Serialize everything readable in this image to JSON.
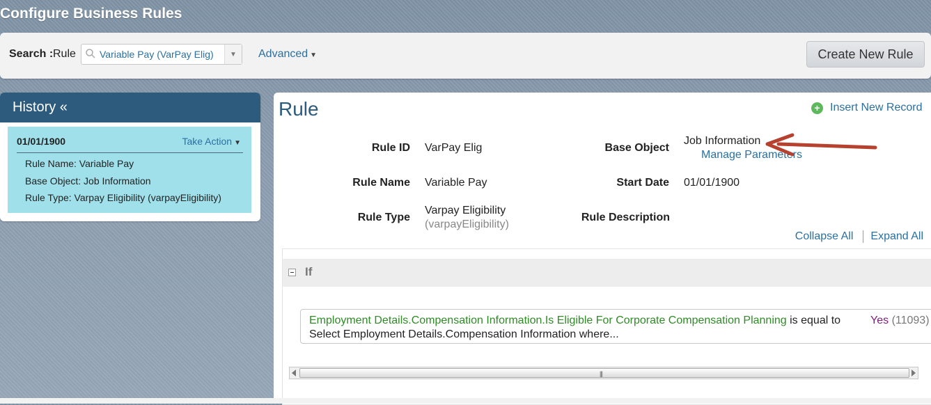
{
  "page": {
    "title": "Configure Business Rules"
  },
  "search": {
    "label": "Search :",
    "sublabel": "Rule",
    "value": "Variable Pay (VarPay Elig)",
    "advanced_label": "Advanced",
    "create_button": "Create New Rule"
  },
  "history": {
    "header": "History «",
    "card": {
      "date": "01/01/1900",
      "action": "Take Action",
      "rows": [
        "Rule Name: Variable Pay",
        "Base Object: Job Information",
        "Rule Type: Varpay Eligibility (varpayEligibility)"
      ]
    }
  },
  "rule": {
    "heading": "Rule",
    "insert_label": "Insert New Record",
    "fields": {
      "rule_id_label": "Rule ID",
      "rule_id_value": "VarPay Elig",
      "base_object_label": "Base Object",
      "base_object_value": "Job Information",
      "manage_params": "Manage Parameters",
      "rule_name_label": "Rule Name",
      "rule_name_value": "Variable Pay",
      "start_date_label": "Start Date",
      "start_date_value": "01/01/1900",
      "rule_type_label": "Rule Type",
      "rule_type_value": "Varpay Eligibility",
      "rule_type_code": "(varpayEligibility)",
      "rule_desc_label": "Rule Description"
    },
    "collapse_all": "Collapse All",
    "expand_all": "Expand All",
    "if_section": {
      "label": "If",
      "condition_field": "Employment Details.Compensation Information.Is Eligible For Corporate Compensation Planning",
      "operator": "is equal to",
      "value": "Yes",
      "value_code": "(11093)",
      "line2": "Select Employment Details.Compensation Information where..."
    }
  },
  "colors": {
    "accent": "#2c5b7e",
    "link": "#2a6fa0",
    "history_card": "#9fe0ea",
    "arrow": "#b5412e"
  }
}
